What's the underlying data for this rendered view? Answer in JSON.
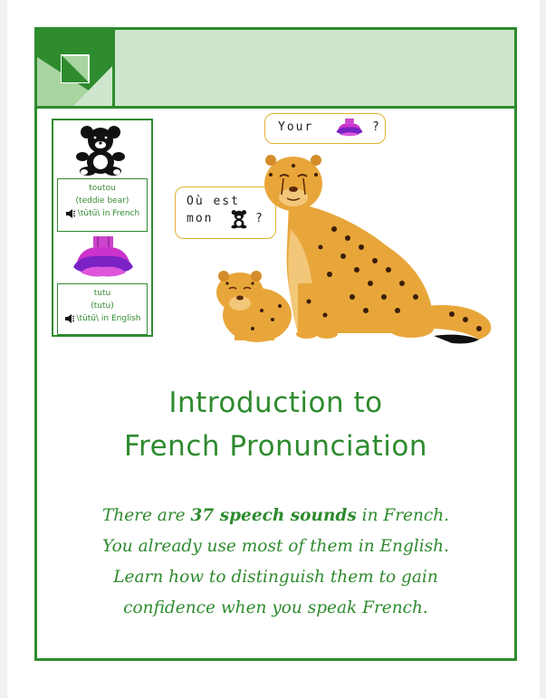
{
  "sidebar": {
    "card1": {
      "word": "toutou",
      "meaning": "(teddie bear)",
      "pronunciation": "\\tūtū\\ in French"
    },
    "card2": {
      "word": "tutu",
      "meaning": "(tutu)",
      "pronunciation": "\\tūtū\\ in English"
    }
  },
  "bubbles": {
    "right": {
      "before": "Your",
      "after": "?"
    },
    "left": {
      "line1": "Où est",
      "line2_before": "mon",
      "line2_after": "?"
    }
  },
  "title": {
    "line1": "Introduction to",
    "line2": "French Pronunciation"
  },
  "intro": {
    "line1_a": "There are ",
    "line1_bold": "37 speech sounds",
    "line1_b": " in French.",
    "line2": "You already use most of them in English.",
    "line3": "Learn how to distinguish them to gain",
    "line4": "confidence when you speak French."
  },
  "colors": {
    "accent_green": "#2e8b2e",
    "header_fill": "#cde6cd",
    "bubble_border": "#e0b030",
    "cheetah": "#e8a63a"
  }
}
